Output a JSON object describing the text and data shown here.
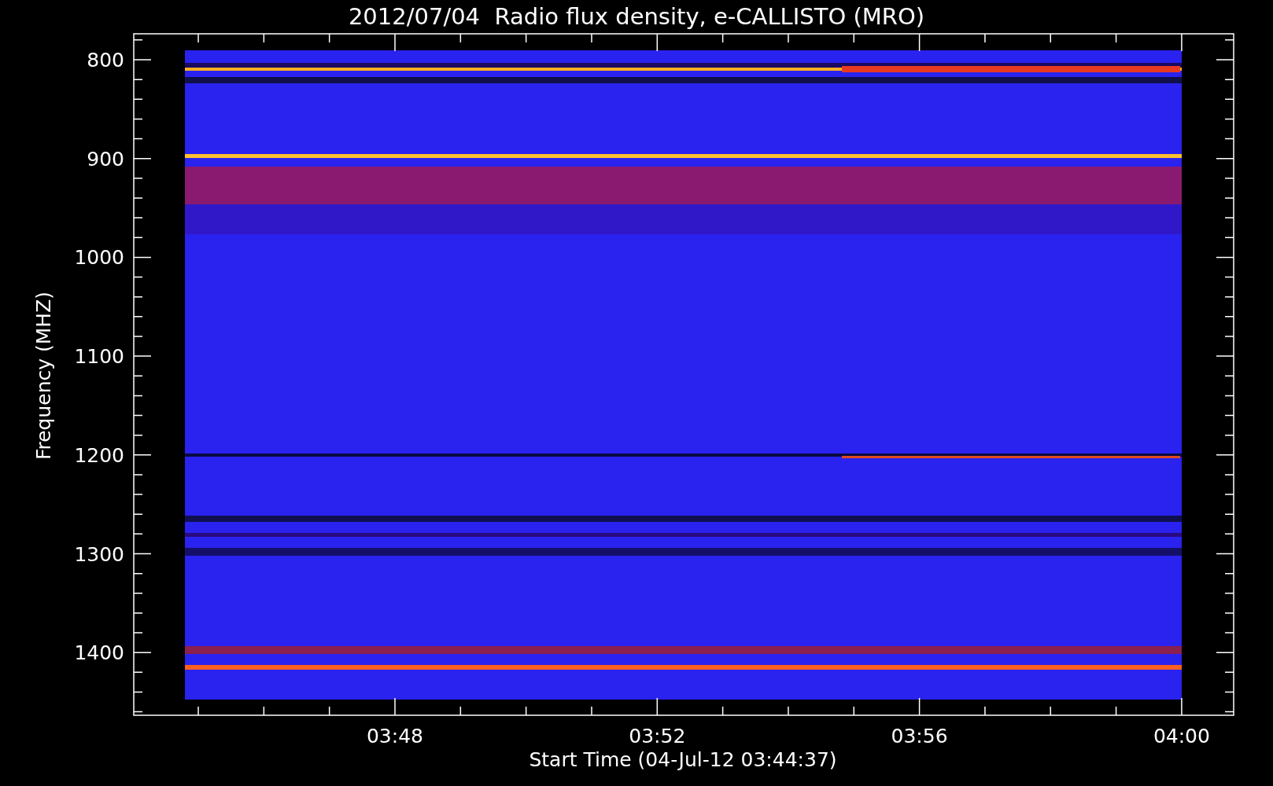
{
  "title": "2012/07/04  Radio flux density, e-CALLISTO (MRO)",
  "y_axis": {
    "label": "Frequency (MHZ)",
    "ticks": [
      "800",
      "900",
      "1000",
      "1100",
      "1200",
      "1300",
      "1400"
    ]
  },
  "x_axis": {
    "label": "Start Time (04-Jul-12 03:44:37)",
    "ticks": [
      "03:48",
      "03:52",
      "03:56",
      "04:00"
    ]
  }
}
